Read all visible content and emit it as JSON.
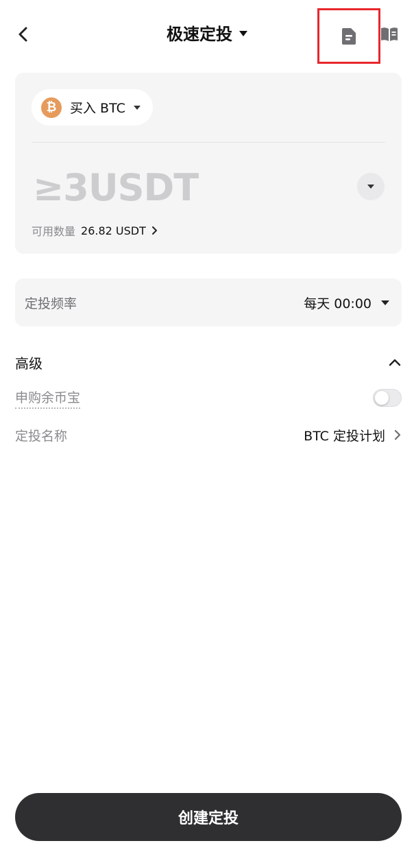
{
  "header": {
    "title": "极速定投",
    "back_icon": "chevron-left-icon",
    "orders_icon": "document-icon",
    "guide_icon": "book-icon"
  },
  "buy": {
    "coin_symbol": "₿",
    "label": "买入 BTC",
    "coin_color": "#e69b5c"
  },
  "amount": {
    "placeholder": "≥3USDT"
  },
  "available": {
    "label": "可用数量",
    "value": "26.82 USDT"
  },
  "frequency": {
    "label": "定投频率",
    "value": "每天 00:00"
  },
  "advanced": {
    "label": "高级",
    "subscribe_label": "申购余币宝",
    "subscribe_enabled": false,
    "plan_name_label": "定投名称",
    "plan_name_value": "BTC 定投计划"
  },
  "footer": {
    "create_label": "创建定投"
  },
  "colors": {
    "highlight_border": "#e8262b",
    "primary_button": "#2f2f31",
    "card_bg": "#f5f5f6"
  }
}
